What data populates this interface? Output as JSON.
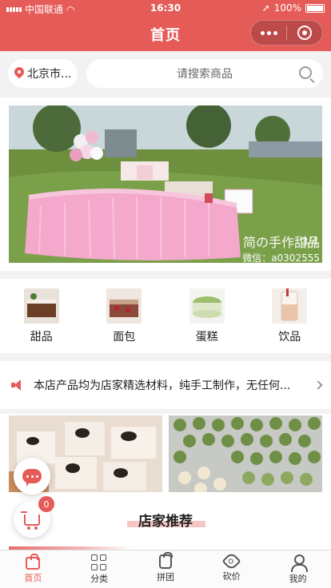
{
  "status_bar": {
    "carrier": "中国联通",
    "time": "16:30",
    "battery": "100%"
  },
  "header": {
    "title": "首页"
  },
  "search": {
    "location": "北京市...",
    "placeholder": "请搜索商品"
  },
  "banner": {
    "counter": "3/4",
    "watermark_brand": "简の手作甜品",
    "watermark_wechat": "微信：a0302555"
  },
  "categories": [
    {
      "label": "甜品",
      "icon": "dessert-thumb"
    },
    {
      "label": "面包",
      "icon": "bread-thumb"
    },
    {
      "label": "蛋糕",
      "icon": "cake-thumb"
    },
    {
      "label": "饮品",
      "icon": "drink-thumb"
    }
  ],
  "notice": {
    "text": "本店产品均为店家精选材料，纯手工制作，无任何..."
  },
  "section": {
    "heading": "店家推荐"
  },
  "cart": {
    "badge": "0"
  },
  "tabbar": [
    {
      "label": "首页",
      "active": true
    },
    {
      "label": "分类"
    },
    {
      "label": "拼团"
    },
    {
      "label": "砍价"
    },
    {
      "label": "我的"
    }
  ],
  "colors": {
    "brand": "#e55b58",
    "background": "#f2f2f2"
  }
}
